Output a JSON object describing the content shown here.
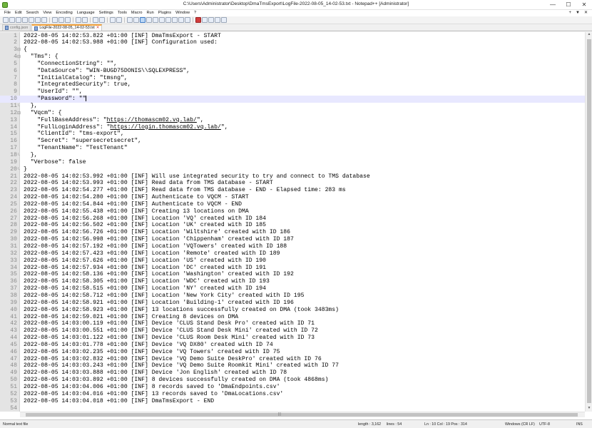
{
  "window": {
    "title": "C:\\Users\\Administrator\\Desktop\\DmaTmsExport\\LogFile-2022-08-05_14-02-53.txt - Notepad++ [Administrator]",
    "minimize": "—",
    "maximize": "☐",
    "close": "✕"
  },
  "menu": {
    "items": [
      "File",
      "Edit",
      "Search",
      "View",
      "Encoding",
      "Language",
      "Settings",
      "Tools",
      "Macro",
      "Run",
      "Plugins",
      "Window",
      "?"
    ],
    "right": [
      "+",
      "▼",
      "✕"
    ]
  },
  "tabs": [
    {
      "label": "config.json",
      "active": false
    },
    {
      "label": "LogFile-2022-08-05_14-02-53.txt",
      "active": true
    }
  ],
  "editor": {
    "current_line": 10,
    "lines": [
      "2022-08-05 14:02:53.822 +01:00 [INF] DmaTmsExport - START",
      "2022-08-05 14:02:53.988 +01:00 [INF] Configuration used:",
      "{",
      "  \"Tms\": {",
      "    \"ConnectionString\": \"\",",
      "    \"DataSource\": \"WIN-BUGD75DONIS\\\\SQLEXPRESS\",",
      "    \"InitialCatalog\": \"tmsng\",",
      "    \"IntegratedSecurity\": true,",
      "    \"UserId\": \"\",",
      "    \"Password\": \"\"",
      "  },",
      "  \"Vqcm\": {",
      "    \"FullBaseAddress\": \"https://thomascm02.vq.lab/\",",
      "    \"FullLoginAddress\": \"https://login.thomascm02.vq.lab/\",",
      "    \"ClientId\": \"tms-export\",",
      "    \"Secret\": \"supersecretsecret\",",
      "    \"TenantName\": \"TestTenant\"",
      "  },",
      "  \"Verbose\": false",
      "}",
      "2022-08-05 14:02:53.992 +01:00 [INF] Will use integrated security to try and connect to TMS database",
      "2022-08-05 14:02:53.993 +01:00 [INF] Read data from TMS database - START",
      "2022-08-05 14:02:54.277 +01:00 [INF] Read data from TMS database - END - Elapsed time: 283 ms",
      "2022-08-05 14:02:54.280 +01:00 [INF] Authenticate to VQCM - START",
      "2022-08-05 14:02:54.844 +01:00 [INF] Authenticate to VQCM - END",
      "2022-08-05 14:02:55.438 +01:00 [INF] Creating 13 locations on DMA",
      "2022-08-05 14:02:56.268 +01:00 [INF] Location 'VQ' created with ID 184",
      "2022-08-05 14:02:56.502 +01:00 [INF] Location 'UK' created with ID 185",
      "2022-08-05 14:02:56.726 +01:00 [INF] Location 'Wiltshire' created with ID 186",
      "2022-08-05 14:02:56.998 +01:00 [INF] Location 'Chippenham' created with ID 187",
      "2022-08-05 14:02:57.192 +01:00 [INF] Location 'VQTowers' created with ID 188",
      "2022-08-05 14:02:57.423 +01:00 [INF] Location 'Remote' created with ID 189",
      "2022-08-05 14:02:57.626 +01:00 [INF] Location 'US' created with ID 190",
      "2022-08-05 14:02:57.934 +01:00 [INF] Location 'DC' created with ID 191",
      "2022-08-05 14:02:58.136 +01:00 [INF] Location 'Washington' created with ID 192",
      "2022-08-05 14:02:58.305 +01:00 [INF] Location 'WDC' created with ID 193",
      "2022-08-05 14:02:58.515 +01:00 [INF] Location 'NY' created with ID 194",
      "2022-08-05 14:02:58.712 +01:00 [INF] Location 'New York City' created with ID 195",
      "2022-08-05 14:02:58.921 +01:00 [INF] Location 'Building-1' created with ID 196",
      "2022-08-05 14:02:58.923 +01:00 [INF] 13 locations successfully created on DMA (took 3483ms)",
      "2022-08-05 14:02:59.021 +01:00 [INF] Creating 8 devices on DMA",
      "2022-08-05 14:03:00.119 +01:00 [INF] Device 'CLUS Stand Desk Pro' created with ID 71",
      "2022-08-05 14:03:00.551 +01:00 [INF] Device 'CLUS Stand Desk Mini' created with ID 72",
      "2022-08-05 14:03:01.122 +01:00 [INF] Device 'CLUS Room Desk Mini' created with ID 73",
      "2022-08-05 14:03:01.778 +01:00 [INF] Device 'VQ DX80' created with ID 74",
      "2022-08-05 14:03:02.235 +01:00 [INF] Device 'VQ Towers' created with ID 75",
      "2022-08-05 14:03:02.832 +01:00 [INF] Device 'VQ Demo Suite DeskPro' created with ID 76",
      "2022-08-05 14:03:03.243 +01:00 [INF] Device 'VQ Demo Suite Roomkit Mini' created with ID 77",
      "2022-08-05 14:03:03.888 +01:00 [INF] Device 'Jon English' created with ID 78",
      "2022-08-05 14:03:03.892 +01:00 [INF] 8 devices successfully created on DMA (took 4868ms)",
      "2022-08-05 14:03:04.006 +01:00 [INF] 8 records saved to 'DmaEndpoints.csv'",
      "2022-08-05 14:03:04.016 +01:00 [INF] 13 records saved to 'DmaLocations.csv'",
      "2022-08-05 14:03:04.018 +01:00 [INF] DmaTmsExport - END",
      ""
    ]
  },
  "status": {
    "file_type": "Normal text file",
    "length": "length : 3,162",
    "lines": "lines : 54",
    "position": "Ln : 10    Col : 19    Pos : 314",
    "eol": "Windows (CR LF)",
    "encoding": "UTF-8",
    "mode": "INS"
  }
}
